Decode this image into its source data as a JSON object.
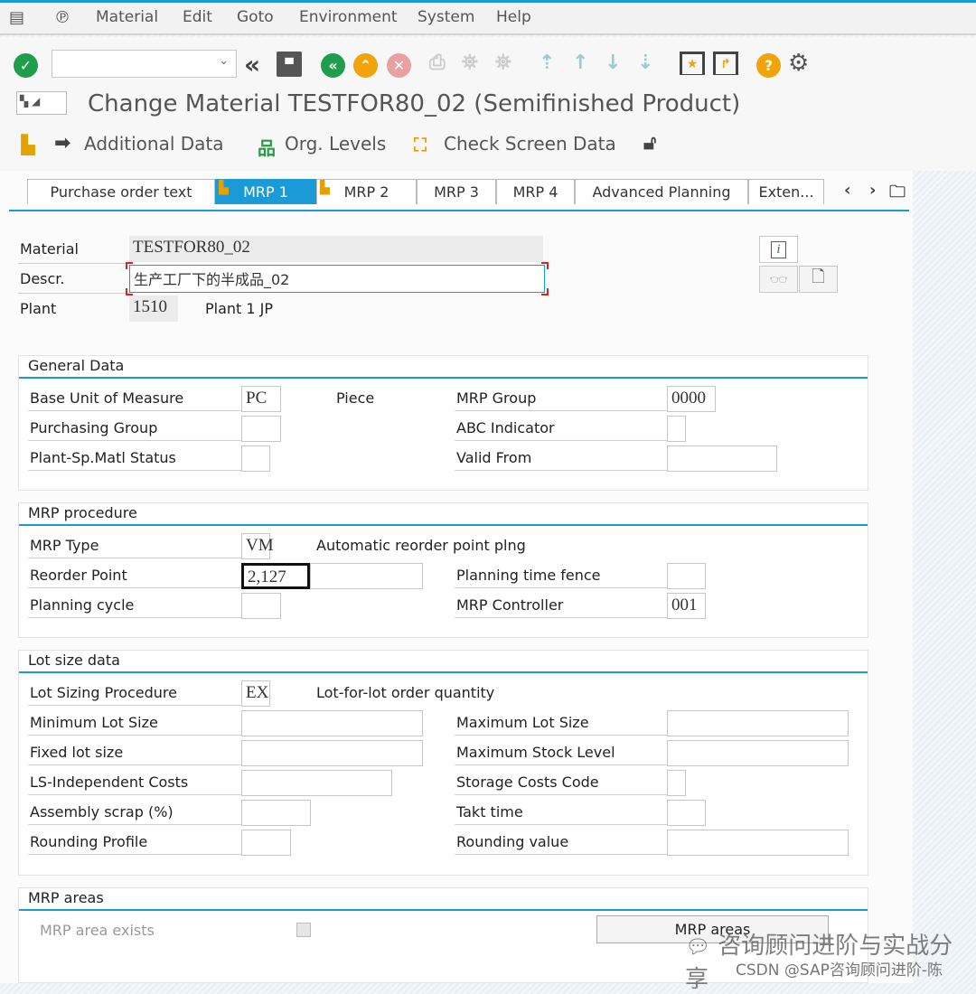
{
  "menu": {
    "items": [
      "Material",
      "Edit",
      "Goto",
      "Environment",
      "System",
      "Help"
    ]
  },
  "toolbar": {
    "okcode_value": "",
    "icons": [
      "check-icon",
      "back-double-icon",
      "save-icon",
      "back-green-icon",
      "exit-icon",
      "cancel-icon",
      "print-icon",
      "find-icon",
      "find-next-icon",
      "first-page-icon",
      "prev-page-icon",
      "next-page-icon",
      "last-page-icon",
      "create-session-icon",
      "shortcut-icon",
      "help-icon",
      "settings-icon"
    ]
  },
  "title": "Change Material TESTFOR80_02 (Semifinished Product)",
  "app_toolbar": {
    "additional_data": "Additional Data",
    "org_levels": "Org. Levels",
    "check_screen_data": "Check Screen Data"
  },
  "tabs": [
    "Purchase order text",
    "MRP 1",
    "MRP 2",
    "MRP 3",
    "MRP 4",
    "Advanced Planning",
    "Exten..."
  ],
  "active_tab": "MRP 1",
  "header": {
    "material_label": "Material",
    "material_value": "TESTFOR80_02",
    "descr_label": "Descr.",
    "descr_value": "生产工厂下的半成品_02",
    "plant_label": "Plant",
    "plant_value": "1510",
    "plant_name": "Plant 1 JP"
  },
  "groups": [
    {
      "title": "General Data",
      "rows": [
        {
          "l": "Base Unit of Measure",
          "v": "PC",
          "t": "Piece",
          "rl": "MRP Group",
          "rv": "0000"
        },
        {
          "l": "Purchasing Group",
          "v": "",
          "rl": "ABC Indicator",
          "rv": ""
        },
        {
          "l": "Plant-Sp.Matl Status",
          "v": "",
          "rl": "Valid From",
          "rv": ""
        }
      ]
    },
    {
      "title": "MRP procedure",
      "rows": [
        {
          "l": "MRP Type",
          "v": "VM",
          "t": "Automatic reorder point plng"
        },
        {
          "l": "Reorder Point",
          "v": "2,127",
          "rl": "Planning time fence",
          "rv": ""
        },
        {
          "l": "Planning cycle",
          "v": "",
          "rl": "MRP Controller",
          "rv": "001"
        }
      ]
    },
    {
      "title": "Lot size data",
      "rows": [
        {
          "l": "Lot Sizing Procedure",
          "v": "EX",
          "t": "Lot-for-lot order quantity"
        },
        {
          "l": "Minimum Lot Size",
          "v": "",
          "rl": "Maximum Lot Size",
          "rv": ""
        },
        {
          "l": "Fixed lot size",
          "v": "",
          "rl": "Maximum Stock Level",
          "rv": ""
        },
        {
          "l": "LS-Independent Costs",
          "v": "",
          "rl": "Storage Costs Code",
          "rv": ""
        },
        {
          "l": "Assembly scrap (%)",
          "v": "",
          "rl": "Takt time",
          "rv": ""
        },
        {
          "l": "Rounding Profile",
          "v": "",
          "rl": "Rounding value",
          "rv": ""
        }
      ]
    }
  ],
  "mrp_areas": {
    "title": "MRP areas",
    "exists_label": "MRP area exists",
    "exists_checked": false,
    "button": "MRP areas"
  },
  "watermark": {
    "line1": "咨询顾问进阶与实战分享",
    "line2": "CSDN @SAP咨询顾问进阶-陈"
  },
  "colors": {
    "accent": "#1a9ad6",
    "ok": "#1e9e4a",
    "warn": "#f0a30a",
    "cancel": "#e8a0a0"
  }
}
